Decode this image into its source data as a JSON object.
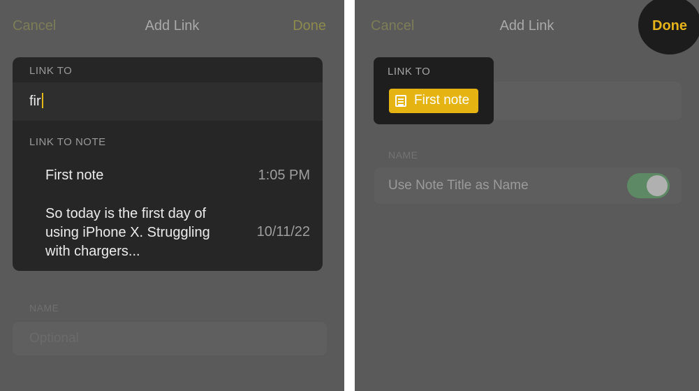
{
  "left": {
    "nav": {
      "cancel": "Cancel",
      "title": "Add Link",
      "done": "Done"
    },
    "link_to_header": "LINK TO",
    "search_value": "fir",
    "link_to_note_header": "LINK TO NOTE",
    "results": [
      {
        "title": "First note",
        "time": "1:05 PM"
      },
      {
        "title": "So today is the first day of using iPhone X. Struggling with chargers...",
        "time": "10/11/22"
      }
    ],
    "name_header": "NAME",
    "name_placeholder": "Optional"
  },
  "right": {
    "nav": {
      "cancel": "Cancel",
      "title": "Add Link",
      "done": "Done"
    },
    "link_to_header": "LINK TO",
    "chip_label": "First note",
    "chip_icon": "note-icon",
    "name_header": "NAME",
    "toggle_label": "Use Note Title as Name",
    "toggle_on": true
  },
  "colors": {
    "accent": "#e5b413",
    "toggle_on": "#5d8a64",
    "dim_overlay": "#5a5a5a",
    "card_bg": "#262626"
  }
}
